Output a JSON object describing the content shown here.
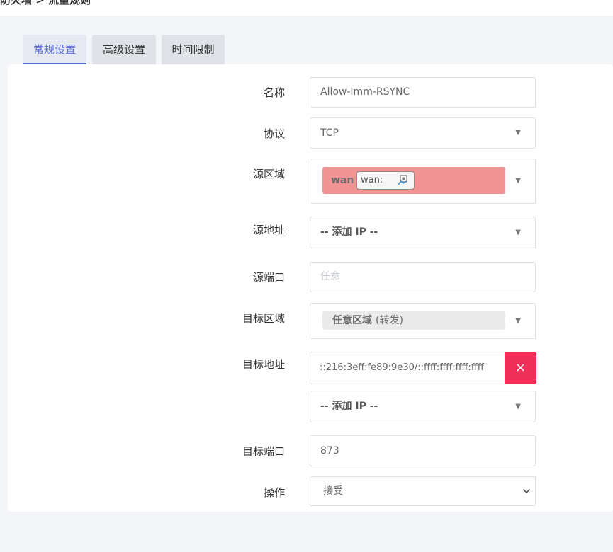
{
  "breadcrumb": {
    "text": "防火墙 > 流量规则"
  },
  "tabs": [
    {
      "label": "常规设置",
      "active": true
    },
    {
      "label": "高级设置",
      "active": false
    },
    {
      "label": "时间限制",
      "active": false
    }
  ],
  "form": {
    "name": {
      "label": "名称",
      "value": "Allow-Imm-RSYNC"
    },
    "protocol": {
      "label": "协议",
      "value": "TCP"
    },
    "src_zone": {
      "label": "源区域",
      "zone_name": "wan",
      "device": "wan:",
      "zone_color": "#f19393"
    },
    "src_addr": {
      "label": "源地址",
      "value": "-- 添加 IP --"
    },
    "src_port": {
      "label": "源端口",
      "placeholder": "任意"
    },
    "dest_zone": {
      "label": "目标区域",
      "value_bold": "任意区域",
      "value_rest": "(转发)"
    },
    "dest_addr": {
      "label": "目标地址",
      "value": "::216:3eff:fe89:9e30/::ffff:ffff:ffff:ffff",
      "remove_label": "×",
      "add_value": "-- 添加 IP --"
    },
    "dest_port": {
      "label": "目标端口",
      "value": "873"
    },
    "action": {
      "label": "操作",
      "value": "接受"
    }
  },
  "icons": {
    "dropdown": "triangle-down-icon",
    "select": "chevron-down-icon",
    "network": "network-port-icon"
  },
  "colors": {
    "accent": "#5b6fd8",
    "danger": "#ef2f57"
  }
}
